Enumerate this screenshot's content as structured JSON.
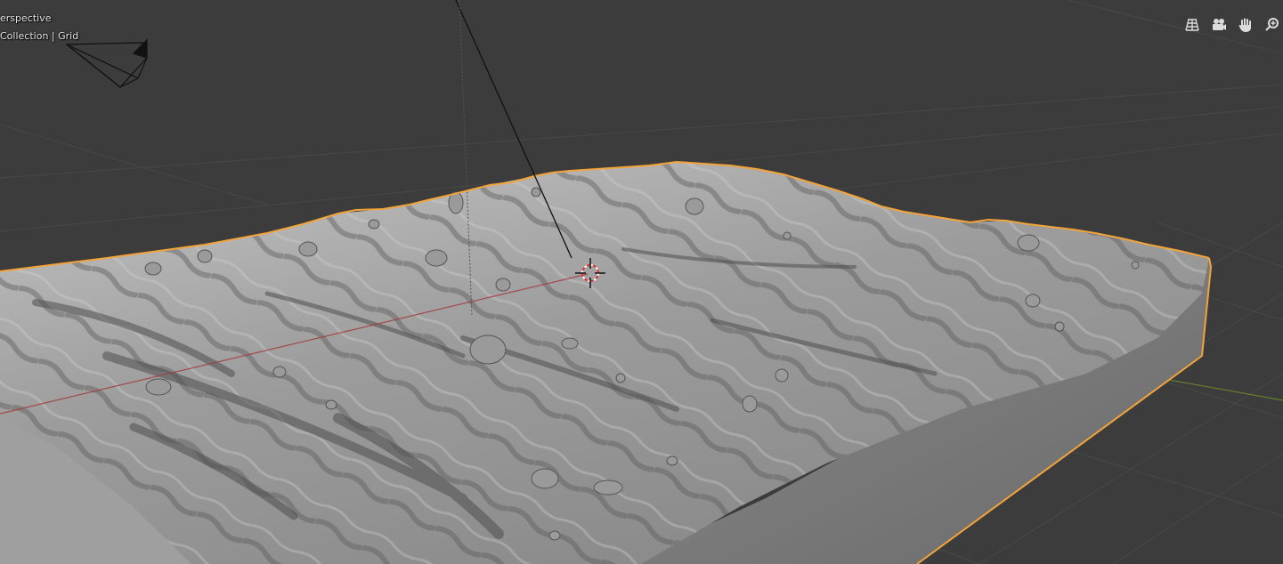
{
  "viewport": {
    "view_name": "erspective",
    "object_info": "Collection | Grid"
  },
  "nav_gizmos": [
    {
      "icon": "grid-perspective-icon"
    },
    {
      "icon": "camera-view-icon"
    },
    {
      "icon": "hand-pan-icon"
    },
    {
      "icon": "zoom-magnifier-icon"
    }
  ],
  "colors": {
    "background": "#3c3c3c",
    "grid_line": "#4a4a4a",
    "x_axis": "#a23c3c",
    "y_axis": "#6e8a2a",
    "selection_outline": "#f2a33a",
    "terrain_light": "#b8b8b8",
    "terrain_dark": "#5a5a5a"
  }
}
